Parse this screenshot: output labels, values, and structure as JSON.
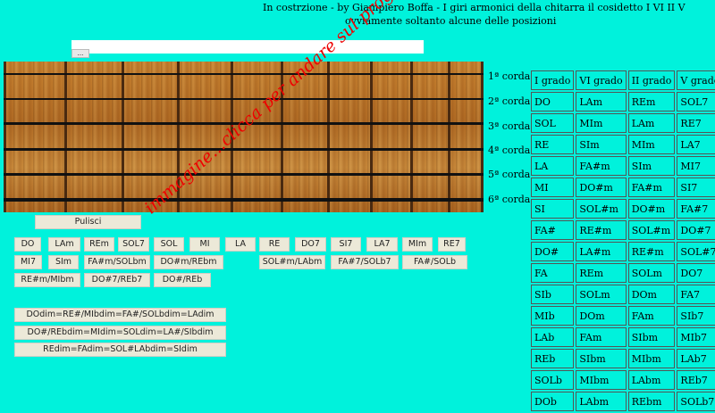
{
  "header": {
    "title": "In costrzione - by Giampiero Boffa - I giri armonici della chitarra il cosidetto I VI II V",
    "subtitle": "ovviamente soltanto alcune delle posizioni",
    "small_button": "..."
  },
  "strings": [
    "1ª corda",
    "2ª corda",
    "3ª corda",
    "4ª corda",
    "5ª corda",
    "6ª corda"
  ],
  "buttons": {
    "clear": "Pulisci",
    "row1": [
      "DO",
      "LAm",
      "REm",
      "SOL7",
      "SOL",
      "MI",
      "LA",
      "RE",
      "DO7",
      "SI7",
      "LA7",
      "MIm",
      "RE7"
    ],
    "row2": [
      "MI7",
      "SIm",
      "FA#m/SOLbm",
      "DO#m/REbm",
      "RE#m/MIbm",
      "SOL#m/LAbm",
      "FA#7/SOLb7",
      "FA#/SOLb"
    ],
    "row3": [
      "DO#7/REb7",
      "DO#/REb"
    ],
    "dim": [
      "DOdim=RE#/MIbdim=FA#/SOLbdim=LAdim",
      "DO#/REbdim=MIdim=SOLdim=LA#/SIbdim",
      "REdim=FAdim=SOL#LAbdim=SIdim"
    ]
  },
  "table": {
    "headers": [
      "I grado",
      "VI grado",
      "II grado",
      "V grado"
    ],
    "rows": [
      [
        "DO",
        "LAm",
        "REm",
        "SOL7"
      ],
      [
        "SOL",
        "MIm",
        "LAm",
        "RE7"
      ],
      [
        "RE",
        "SIm",
        "MIm",
        "LA7"
      ],
      [
        "LA",
        "FA#m",
        "SIm",
        "MI7"
      ],
      [
        "MI",
        "DO#m",
        "FA#m",
        "SI7"
      ],
      [
        "SI",
        "SOL#m",
        "DO#m",
        "FA#7"
      ],
      [
        "FA#",
        "RE#m",
        "SOL#m",
        "DO#7"
      ],
      [
        "DO#",
        "LA#m",
        "RE#m",
        "SOL#7"
      ],
      [
        "FA",
        "REm",
        "SOLm",
        "DO7"
      ],
      [
        "SIb",
        "SOLm",
        "DOm",
        "FA7"
      ],
      [
        "MIb",
        "DOm",
        "FAm",
        "SIb7"
      ],
      [
        "LAb",
        "FAm",
        "SIbm",
        "MIb7"
      ],
      [
        "REb",
        "SIbm",
        "MIbm",
        "LAb7"
      ],
      [
        "SOLb",
        "MIbm",
        "LAbm",
        "REb7"
      ],
      [
        "DOb",
        "LAbm",
        "REbm",
        "SOLb7"
      ]
    ]
  },
  "watermark": "immagine...clicca per andare sul programma"
}
